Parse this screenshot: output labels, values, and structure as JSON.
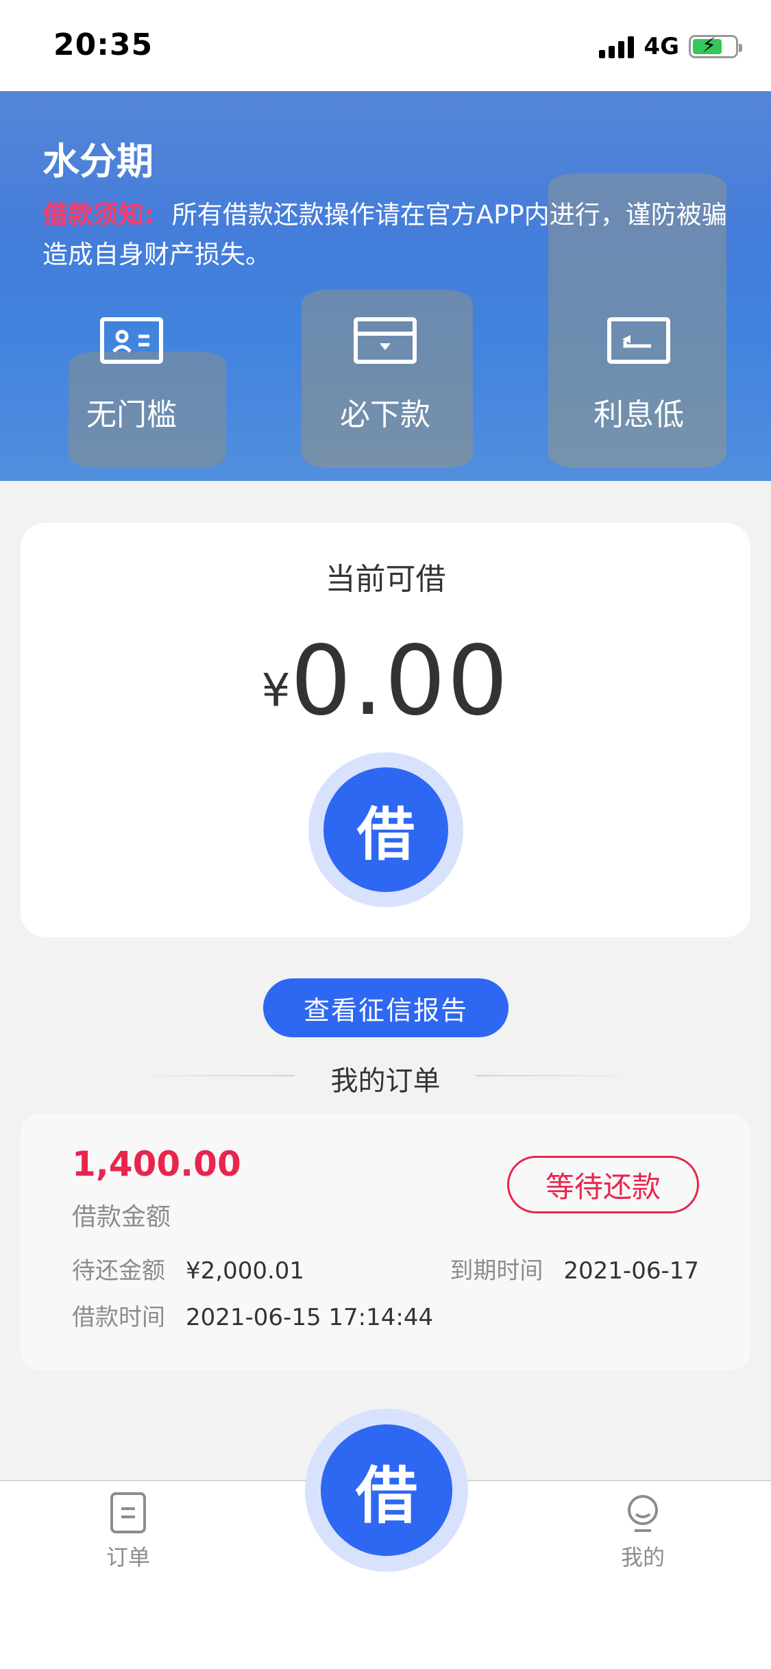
{
  "status_bar": {
    "time": "20:35",
    "network": "4G"
  },
  "banner": {
    "title": "水分期",
    "notice_label": "借款须知:",
    "notice_text": "所有借款还款操作请在官方APP内进行，谨防被骗造成自身财产损失。",
    "features": [
      {
        "label": "无门槛",
        "icon": "id-card-icon"
      },
      {
        "label": "必下款",
        "icon": "card-icon"
      },
      {
        "label": "利息低",
        "icon": "return-icon"
      }
    ]
  },
  "borrow_card": {
    "title": "当前可借",
    "currency_symbol": "¥",
    "amount": "0.00",
    "button_label": "借"
  },
  "credit_report_button": "查看征信报告",
  "orders_section": {
    "title": "我的订单",
    "order": {
      "amount": "1,400.00",
      "amount_label": "借款金额",
      "status": "等待还款",
      "pending_label": "待还金额",
      "pending_value": "¥2,000.01",
      "due_label": "到期时间",
      "due_value": "2021-06-17",
      "borrow_time_label": "借款时间",
      "borrow_time_value": "2021-06-15 17:14:44"
    }
  },
  "tab_bar": {
    "left_label": "订单",
    "center_label": "借",
    "right_label": "我的"
  },
  "colors": {
    "primary": "#2e67f2",
    "accent_red": "#e8264d",
    "background": "#f2f2f2"
  }
}
